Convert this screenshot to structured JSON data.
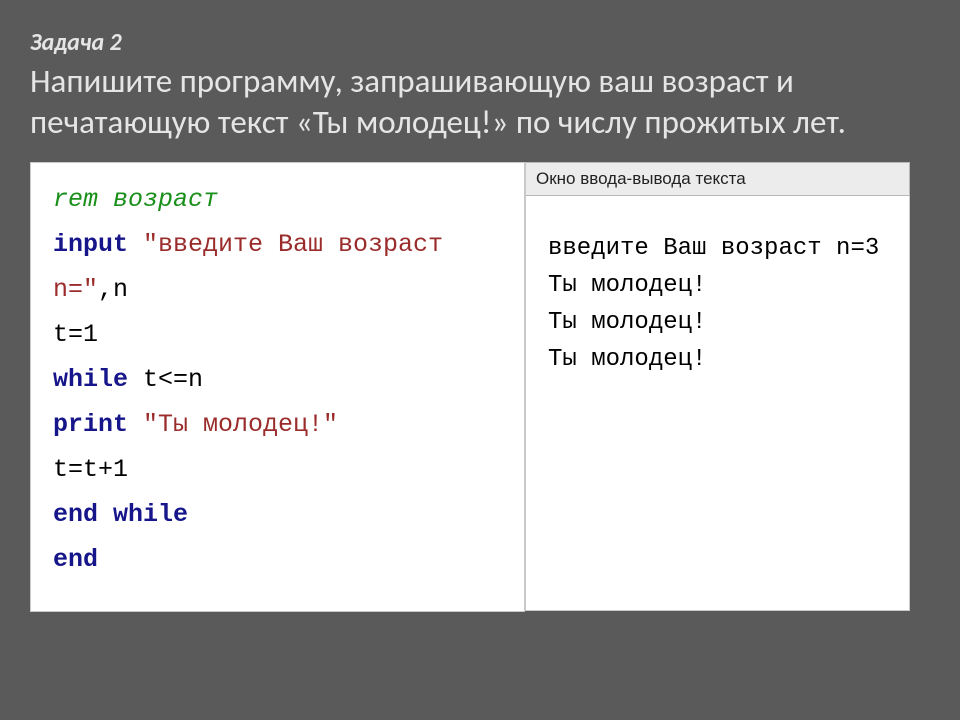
{
  "title": "Задача 2",
  "task": "Напишите программу, запрашивающую ваш возраст и печатающую текст «Ты молодец!» по числу прожитых лет.",
  "code": {
    "line1_rem": "rem возраст",
    "line2_kw": "input ",
    "line2_str": "\"введите Ваш возраст n=\"",
    "line2_tail": ",n",
    "line3": "t=1",
    "line4_kw": "while ",
    "line4_expr": "t<=n",
    "line5_kw": "print ",
    "line5_str": "\"Ты молодец!\"",
    "line6": "t=t+1",
    "line7_kw": "end while",
    "line8_kw": "end"
  },
  "output": {
    "title": "Окно ввода-вывода текста",
    "lines": {
      "l1": "введите Ваш возраст n=3",
      "l2": "Ты молодец!",
      "l3": "Ты молодец!",
      "l4": "Ты молодец!"
    }
  }
}
